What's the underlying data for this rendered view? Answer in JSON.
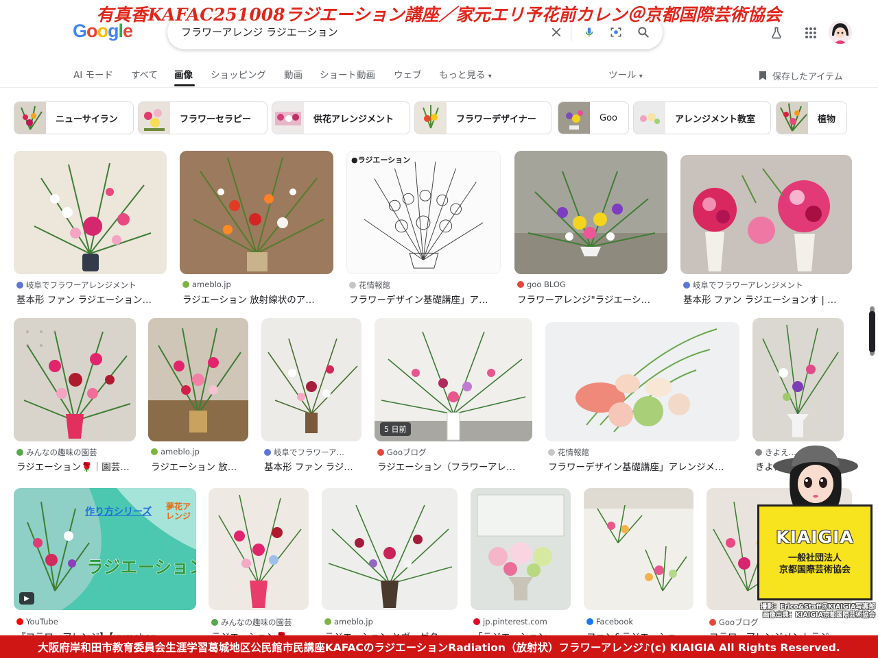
{
  "overlay": {
    "top_banner": "有真香KAFAC251008ラジエーション講座／家元エリ予花前カレン＠京都国際芸術協会",
    "bottom_banner": "大阪府岸和田市教育委員会生涯学習葛城地区公民館市民講座KAFACのラジエーションRadiation（放射状）フラワーアレンジ♪(c) KIAIGIA All Rights Reserved.",
    "kiaigia_name": "KIAIGIA",
    "kiaigia_org_line1": "一般社団法人",
    "kiaigia_org_line2": "京都国際芸術協会",
    "credit_line1": "撮影：Erico&Staff＠KIAIGIA写真部",
    "credit_line2": "画像出典：KIAIGIA京都国際芸術協会"
  },
  "header": {
    "logo": "Google",
    "search_query": "フラワーアレンジ ラジエーション"
  },
  "nav": {
    "tabs": [
      "AI モード",
      "すべて",
      "画像",
      "ショッピング",
      "動画",
      "ショート動画",
      "ウェブ",
      "もっと見る"
    ],
    "active_tab": "画像",
    "tools": "ツール",
    "saved_items": "保存したアイテム"
  },
  "chips": [
    "ニューサイラン",
    "フラワーセラピー",
    "供花アレンジメント",
    "フラワーデザイナー",
    "Goo",
    "アレンジメント教室",
    "植物"
  ],
  "row1": [
    {
      "source": "岐阜でフラワーアレンジメント",
      "title": "基本形 ファン ラジエーション…"
    },
    {
      "source": "ameblo.jp",
      "title": "ラジエーション 放射線状のア…"
    },
    {
      "source": "花情報館",
      "title": "フラワーデザイン基礎講座」ア…",
      "image_label": "●ラジエーション"
    },
    {
      "source": "goo BLOG",
      "title": "フラワーアレンジ\"ラジエーシ…"
    },
    {
      "source": "岐阜でフラワーアレンジメント",
      "title": "基本形 ファン ラジエーションす | …"
    }
  ],
  "row2": [
    {
      "source": "みんなの趣味の園芸",
      "title": "ラジエーション🌹｜園芸…"
    },
    {
      "source": "ameblo.jp",
      "title": "ラジエーション 放…"
    },
    {
      "source": "岐阜でフラワーア…",
      "title": "基本形 ファン ラジ…"
    },
    {
      "source": "Gooブログ",
      "title": "ラジエーション（フラワーアレ…",
      "badge": "5 日前"
    },
    {
      "source": "花情報館",
      "title": "フラワーデザイン基礎講座」アレンジメ…"
    },
    {
      "source": "きよえ…",
      "title": "きよえ…"
    }
  ],
  "row3": [
    {
      "source": "YouTube",
      "title": "『フラワーアレンジ】【yumehan…",
      "image_text1": "作り方シリーズ",
      "image_text2": "ラジエーション",
      "image_text3": "夢花アレンジ"
    },
    {
      "source": "みんなの趣味の園芸",
      "title": "ラジエーション🌹…"
    },
    {
      "source": "ameblo.jp",
      "title": "ラジエーション とヴェゲタ…"
    },
    {
      "source": "jp.pinterest.com",
      "title": "「ラジエーション…"
    },
    {
      "source": "Facebook",
      "title": "ファン&ラジエーショ…"
    },
    {
      "source": "Gooブログ",
      "title": "フラワーアレンジメントラジ…"
    }
  ]
}
